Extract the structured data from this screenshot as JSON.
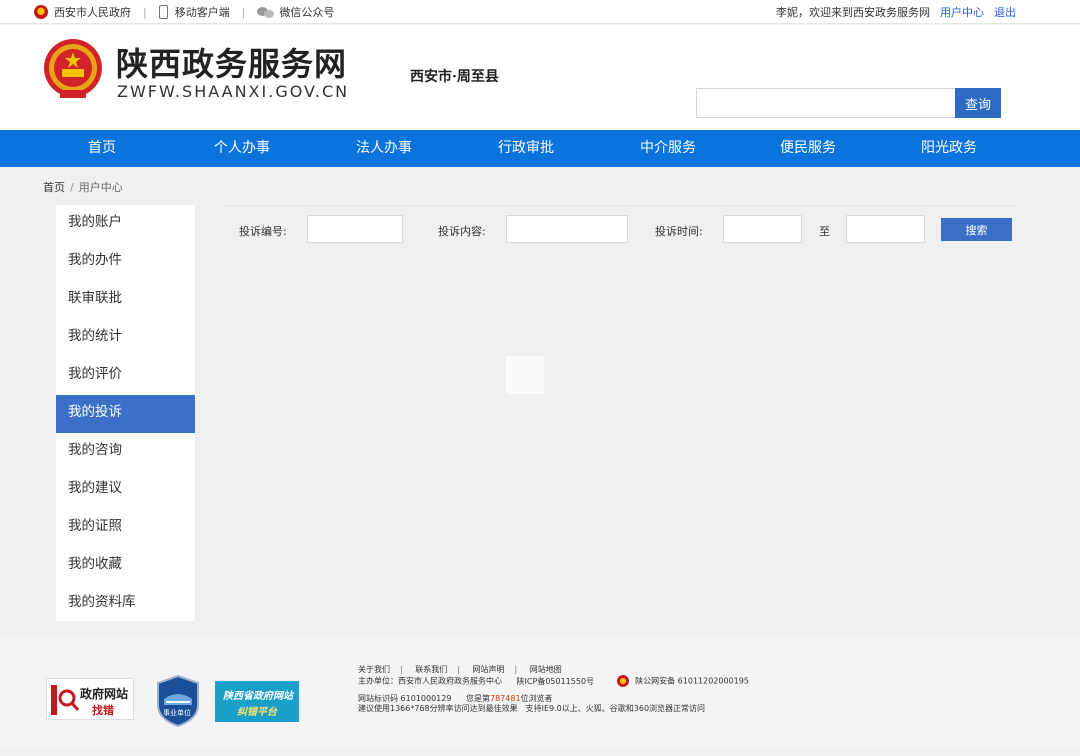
{
  "topbar": {
    "gov_link": "西安市人民政府",
    "mobile_link": "移动客户端",
    "wechat_link": "微信公众号",
    "welcome": "李妮，欢迎来到西安政务服务网",
    "user_center": "用户中心",
    "logout": "退出"
  },
  "header": {
    "site_title": "陕西政务服务网",
    "site_url": "ZWFW.SHAANXI.GOV.CN",
    "region": "西安市·周至县",
    "search_value": "",
    "search_button": "查询"
  },
  "nav": [
    "首页",
    "个人办事",
    "法人办事",
    "行政审批",
    "中介服务",
    "便民服务",
    "阳光政务"
  ],
  "breadcrumb": {
    "home": "首页",
    "current": "用户中心"
  },
  "sidebar": {
    "items": [
      "我的账户",
      "我的办件",
      "联审联批",
      "我的统计",
      "我的评价",
      "我的投诉",
      "我的咨询",
      "我的建议",
      "我的证照",
      "我的收藏",
      "我的资料库"
    ],
    "active": "我的投诉"
  },
  "filters": {
    "complaint_no_label": "投诉编号:",
    "complaint_content_label": "投诉内容:",
    "complaint_time_label": "投诉时间:",
    "to_label": "至",
    "search_button": "搜索"
  },
  "footer": {
    "links": [
      "关于我们",
      "联系我们",
      "网站声明",
      "网站地图"
    ],
    "sponsor": "主办单位：西安市人民政府政务服务中心",
    "icp": "陕ICP备05011550号",
    "police": "陕公网安备 61011202000195",
    "site_id": "网站标识码 6101000129",
    "visitor_prefix": "您是第",
    "visitor_count": "787481",
    "visitor_suffix": "位浏览者",
    "advice": "建议使用1366*768分辨率访问达到最佳效果　支持IE9.0以上、火狐、谷歌和360浏览器正常访问",
    "badge_error_1": "政府网站",
    "badge_error_2": "找错",
    "badge_public": "事业单位",
    "badge_platform_1": "陕西省政府网站",
    "badge_platform_2": "纠错平台"
  }
}
